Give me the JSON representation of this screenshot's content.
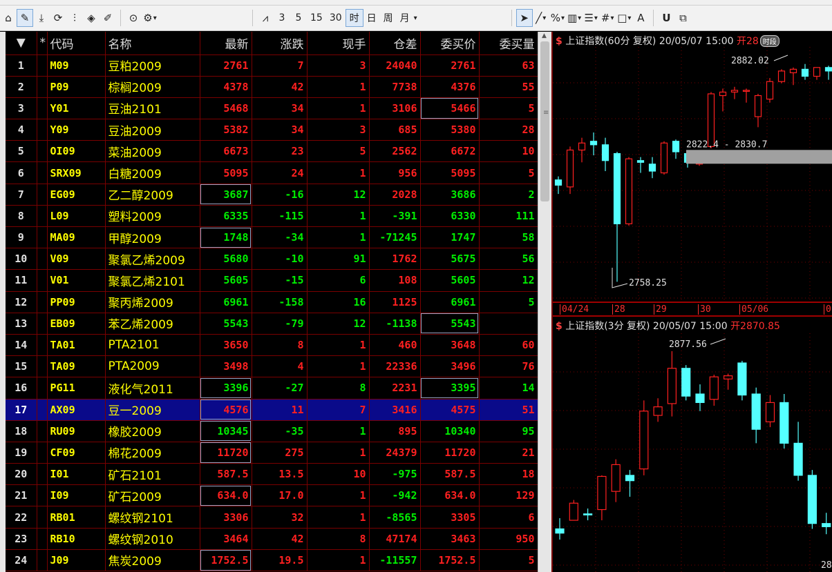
{
  "toolbar": {
    "periods": [
      "3",
      "5",
      "15",
      "30",
      "时",
      "日",
      "周",
      "月"
    ],
    "active_period": "时",
    "symbols": {
      "percent": "%",
      "text_tool": "A",
      "underline_tool": "U"
    }
  },
  "table": {
    "headers": [
      "",
      "*",
      "代码",
      "名称",
      "最新",
      "涨跌",
      "现手",
      "仓差",
      "委买价",
      "委买量"
    ],
    "rows": [
      {
        "idx": "1",
        "code": "M09",
        "name": "豆粕2009",
        "last": "2761",
        "chg": "7",
        "vol": "3",
        "oi": "24040",
        "bid": "2761",
        "bidq": "63",
        "chgdir": "up",
        "oidir": "up",
        "boxcol": ""
      },
      {
        "idx": "2",
        "code": "P09",
        "name": "棕榈2009",
        "last": "4378",
        "chg": "42",
        "vol": "1",
        "oi": "7738",
        "bid": "4376",
        "bidq": "55",
        "chgdir": "up",
        "oidir": "up",
        "boxcol": ""
      },
      {
        "idx": "3",
        "code": "Y01",
        "name": "豆油2101",
        "last": "5468",
        "chg": "34",
        "vol": "1",
        "oi": "3106",
        "bid": "5466",
        "bidq": "5",
        "chgdir": "up",
        "oidir": "up",
        "boxcol": "bid"
      },
      {
        "idx": "4",
        "code": "Y09",
        "name": "豆油2009",
        "last": "5382",
        "chg": "34",
        "vol": "3",
        "oi": "685",
        "bid": "5380",
        "bidq": "28",
        "chgdir": "up",
        "oidir": "up",
        "boxcol": ""
      },
      {
        "idx": "5",
        "code": "OI09",
        "name": "菜油2009",
        "last": "6673",
        "chg": "23",
        "vol": "5",
        "oi": "2562",
        "bid": "6672",
        "bidq": "10",
        "chgdir": "up",
        "oidir": "up",
        "boxcol": ""
      },
      {
        "idx": "6",
        "code": "SRX09",
        "name": "白糖2009",
        "last": "5095",
        "chg": "24",
        "vol": "1",
        "oi": "956",
        "bid": "5095",
        "bidq": "5",
        "chgdir": "up",
        "oidir": "up",
        "boxcol": ""
      },
      {
        "idx": "7",
        "code": "EG09",
        "name": "乙二醇2009",
        "last": "3687",
        "chg": "-16",
        "vol": "12",
        "oi": "2028",
        "bid": "3686",
        "bidq": "2",
        "chgdir": "dn",
        "oidir": "up",
        "boxcol": "last"
      },
      {
        "idx": "8",
        "code": "L09",
        "name": "塑料2009",
        "last": "6335",
        "chg": "-115",
        "vol": "1",
        "oi": "-391",
        "bid": "6330",
        "bidq": "111",
        "chgdir": "dn",
        "oidir": "dn",
        "boxcol": ""
      },
      {
        "idx": "9",
        "code": "MA09",
        "name": "甲醇2009",
        "last": "1748",
        "chg": "-34",
        "vol": "1",
        "oi": "-71245",
        "bid": "1747",
        "bidq": "58",
        "chgdir": "dn",
        "oidir": "dn",
        "boxcol": "last"
      },
      {
        "idx": "10",
        "code": "V09",
        "name": "聚氯乙烯2009",
        "last": "5680",
        "chg": "-10",
        "vol": "91",
        "oi": "1762",
        "bid": "5675",
        "bidq": "56",
        "chgdir": "dn",
        "oidir": "up",
        "boxcol": ""
      },
      {
        "idx": "11",
        "code": "V01",
        "name": "聚氯乙烯2101",
        "last": "5605",
        "chg": "-15",
        "vol": "6",
        "oi": "108",
        "bid": "5605",
        "bidq": "12",
        "chgdir": "dn",
        "oidir": "up",
        "boxcol": ""
      },
      {
        "idx": "12",
        "code": "PP09",
        "name": "聚丙烯2009",
        "last": "6961",
        "chg": "-158",
        "vol": "16",
        "oi": "1125",
        "bid": "6961",
        "bidq": "5",
        "chgdir": "dn",
        "oidir": "up",
        "boxcol": ""
      },
      {
        "idx": "13",
        "code": "EB09",
        "name": "苯乙烯2009",
        "last": "5543",
        "chg": "-79",
        "vol": "12",
        "oi": "-1138",
        "bid": "5543",
        "bidq": "",
        "chgdir": "dn",
        "oidir": "dn",
        "boxcol": "bid"
      },
      {
        "idx": "14",
        "code": "TA01",
        "name": "PTA2101",
        "last": "3650",
        "chg": "8",
        "vol": "1",
        "oi": "460",
        "bid": "3648",
        "bidq": "60",
        "chgdir": "up",
        "oidir": "up",
        "boxcol": ""
      },
      {
        "idx": "15",
        "code": "TA09",
        "name": "PTA2009",
        "last": "3498",
        "chg": "4",
        "vol": "1",
        "oi": "22336",
        "bid": "3496",
        "bidq": "76",
        "chgdir": "up",
        "oidir": "up",
        "boxcol": ""
      },
      {
        "idx": "16",
        "code": "PG11",
        "name": "液化气2011",
        "last": "3396",
        "chg": "-27",
        "vol": "8",
        "oi": "2231",
        "bid": "3395",
        "bidq": "14",
        "chgdir": "dn",
        "oidir": "up",
        "boxcol": "both"
      },
      {
        "idx": "17",
        "code": "AX09",
        "name": "豆一2009",
        "last": "4576",
        "chg": "11",
        "vol": "7",
        "oi": "3416",
        "bid": "4575",
        "bidq": "51",
        "chgdir": "up",
        "oidir": "up",
        "boxcol": "last",
        "selected": true
      },
      {
        "idx": "18",
        "code": "RU09",
        "name": "橡胶2009",
        "last": "10345",
        "chg": "-35",
        "vol": "1",
        "oi": "895",
        "bid": "10340",
        "bidq": "95",
        "chgdir": "dn",
        "oidir": "up",
        "boxcol": "last"
      },
      {
        "idx": "19",
        "code": "CF09",
        "name": "棉花2009",
        "last": "11720",
        "chg": "275",
        "vol": "1",
        "oi": "24379",
        "bid": "11720",
        "bidq": "21",
        "chgdir": "up",
        "oidir": "up",
        "boxcol": "last"
      },
      {
        "idx": "20",
        "code": "I01",
        "name": "矿石2101",
        "last": "587.5",
        "chg": "13.5",
        "vol": "10",
        "oi": "-975",
        "bid": "587.5",
        "bidq": "18",
        "chgdir": "up",
        "oidir": "dn",
        "boxcol": ""
      },
      {
        "idx": "21",
        "code": "I09",
        "name": "矿石2009",
        "last": "634.0",
        "chg": "17.0",
        "vol": "1",
        "oi": "-942",
        "bid": "634.0",
        "bidq": "129",
        "chgdir": "up",
        "oidir": "dn",
        "boxcol": "last"
      },
      {
        "idx": "22",
        "code": "RB01",
        "name": "螺纹钢2101",
        "last": "3306",
        "chg": "32",
        "vol": "1",
        "oi": "-8565",
        "bid": "3305",
        "bidq": "6",
        "chgdir": "up",
        "oidir": "dn",
        "boxcol": ""
      },
      {
        "idx": "23",
        "code": "RB10",
        "name": "螺纹钢2010",
        "last": "3464",
        "chg": "42",
        "vol": "8",
        "oi": "47174",
        "bid": "3463",
        "bidq": "950",
        "chgdir": "up",
        "oidir": "up",
        "boxcol": ""
      },
      {
        "idx": "24",
        "code": "J09",
        "name": "焦炭2009",
        "last": "1752.5",
        "chg": "19.5",
        "vol": "1",
        "oi": "-11557",
        "bid": "1752.5",
        "bidq": "5",
        "chgdir": "up",
        "oidir": "dn",
        "boxcol": "last"
      }
    ]
  },
  "chart_top": {
    "icon": "$",
    "title": "上证指数(60分 复权) 20/05/07 15:00",
    "open_label": "开28",
    "badge": "时段",
    "high_label": "2882.02",
    "low_label": "2758.25",
    "range_label": "2822.4 - 2830.7",
    "dates": [
      "04/24",
      "28",
      "29",
      "30",
      "05/06",
      "0"
    ]
  },
  "chart_bottom": {
    "icon": "$",
    "title": "上证指数(3分 复权) 20/05/07 15:00",
    "open_label": "开2870.85",
    "high_label": "2877.56",
    "corner_label": "28"
  },
  "chart_data": [
    {
      "type": "candlestick",
      "title": "上证指数(60分 复权) 20/05/07 15:00",
      "ylim": [
        2755,
        2887
      ],
      "annotations": [
        "2882.02",
        "2758.25",
        "2822.4 - 2830.7"
      ],
      "x_ticks": [
        "04/24",
        "28",
        "29",
        "30",
        "05/06"
      ],
      "candles": [
        {
          "o": 2816,
          "h": 2818,
          "l": 2808,
          "c": 2813
        },
        {
          "o": 2812,
          "h": 2835,
          "l": 2808,
          "c": 2833
        },
        {
          "o": 2833,
          "h": 2840,
          "l": 2826,
          "c": 2837
        },
        {
          "o": 2838,
          "h": 2843,
          "l": 2830,
          "c": 2836
        },
        {
          "o": 2836,
          "h": 2840,
          "l": 2821,
          "c": 2827
        },
        {
          "o": 2831,
          "h": 2832,
          "l": 2758,
          "c": 2791
        },
        {
          "o": 2791,
          "h": 2829,
          "l": 2790,
          "c": 2828
        },
        {
          "o": 2827,
          "h": 2829,
          "l": 2820,
          "c": 2826
        },
        {
          "o": 2825,
          "h": 2829,
          "l": 2817,
          "c": 2821
        },
        {
          "o": 2820,
          "h": 2838,
          "l": 2819,
          "c": 2837
        },
        {
          "o": 2838,
          "h": 2839,
          "l": 2828,
          "c": 2832
        },
        {
          "o": 2831,
          "h": 2832,
          "l": 2823,
          "c": 2826
        },
        {
          "o": 2825,
          "h": 2830,
          "l": 2824,
          "c": 2829
        },
        {
          "o": 2835,
          "h": 2866,
          "l": 2834,
          "c": 2865
        },
        {
          "o": 2864,
          "h": 2868,
          "l": 2855,
          "c": 2866
        },
        {
          "o": 2866,
          "h": 2869,
          "l": 2862,
          "c": 2867
        },
        {
          "o": 2867,
          "h": 2868,
          "l": 2860,
          "c": 2867
        },
        {
          "o": 2852,
          "h": 2865,
          "l": 2846,
          "c": 2864
        },
        {
          "o": 2862,
          "h": 2874,
          "l": 2860,
          "c": 2872
        },
        {
          "o": 2872,
          "h": 2879,
          "l": 2871,
          "c": 2878
        },
        {
          "o": 2877,
          "h": 2880,
          "l": 2870,
          "c": 2879
        },
        {
          "o": 2879,
          "h": 2882,
          "l": 2873,
          "c": 2875
        },
        {
          "o": 2875,
          "h": 2880,
          "l": 2873,
          "c": 2880
        },
        {
          "o": 2880,
          "h": 2881,
          "l": 2873,
          "c": 2878
        }
      ]
    },
    {
      "type": "candlestick",
      "title": "上证指数(3分 复权) 20/05/07 15:00",
      "ylim": [
        2858,
        2878.5
      ],
      "annotations": [
        "2877.56"
      ],
      "candles": [
        {
          "o": 2861.0,
          "h": 2862.0,
          "l": 2860.0,
          "c": 2860.6
        },
        {
          "o": 2861.8,
          "h": 2863.7,
          "l": 2861.8,
          "c": 2863.4
        },
        {
          "o": 2862.4,
          "h": 2862.9,
          "l": 2861.8,
          "c": 2862.3
        },
        {
          "o": 2862.8,
          "h": 2866.0,
          "l": 2861.8,
          "c": 2865.9
        },
        {
          "o": 2864.5,
          "h": 2867.5,
          "l": 2863.5,
          "c": 2867.0
        },
        {
          "o": 2866.0,
          "h": 2866.5,
          "l": 2864.0,
          "c": 2865.5
        },
        {
          "o": 2866.6,
          "h": 2873.0,
          "l": 2866.0,
          "c": 2872.0
        },
        {
          "o": 2871.6,
          "h": 2873.2,
          "l": 2871.0,
          "c": 2872.4
        },
        {
          "o": 2872.7,
          "h": 2877.6,
          "l": 2871.5,
          "c": 2876.0
        },
        {
          "o": 2876.0,
          "h": 2876.3,
          "l": 2873.0,
          "c": 2873.4
        },
        {
          "o": 2873.6,
          "h": 2874.5,
          "l": 2872.0,
          "c": 2872.8
        },
        {
          "o": 2873.1,
          "h": 2875.4,
          "l": 2872.5,
          "c": 2875.2
        },
        {
          "o": 2875.0,
          "h": 2875.5,
          "l": 2874.0,
          "c": 2875.3
        },
        {
          "o": 2876.5,
          "h": 2876.7,
          "l": 2873.0,
          "c": 2873.5
        },
        {
          "o": 2873.6,
          "h": 2874.2,
          "l": 2869.0,
          "c": 2870.3
        },
        {
          "o": 2871.0,
          "h": 2873.5,
          "l": 2870.5,
          "c": 2872.8
        },
        {
          "o": 2872.8,
          "h": 2873.6,
          "l": 2868.5,
          "c": 2869.0
        },
        {
          "o": 2869.0,
          "h": 2871.0,
          "l": 2865.5,
          "c": 2866.0
        },
        {
          "o": 2866.0,
          "h": 2866.5,
          "l": 2861.0,
          "c": 2861.5
        },
        {
          "o": 2861.5,
          "h": 2862.5,
          "l": 2860.5,
          "c": 2861.2
        },
        {
          "o": 2861.6,
          "h": 2862.0,
          "l": 2858.0,
          "c": 2858.8
        },
        {
          "o": 2857.9,
          "h": 2861.8,
          "l": 2857.7,
          "c": 2861.6
        }
      ]
    }
  ],
  "colors": {
    "up": "#ff2020",
    "down": "#00ee00",
    "candle_down": "#54ffff",
    "code": "#ffff00",
    "grid": "#7a0000",
    "selected_row": "#0a0a8a"
  }
}
